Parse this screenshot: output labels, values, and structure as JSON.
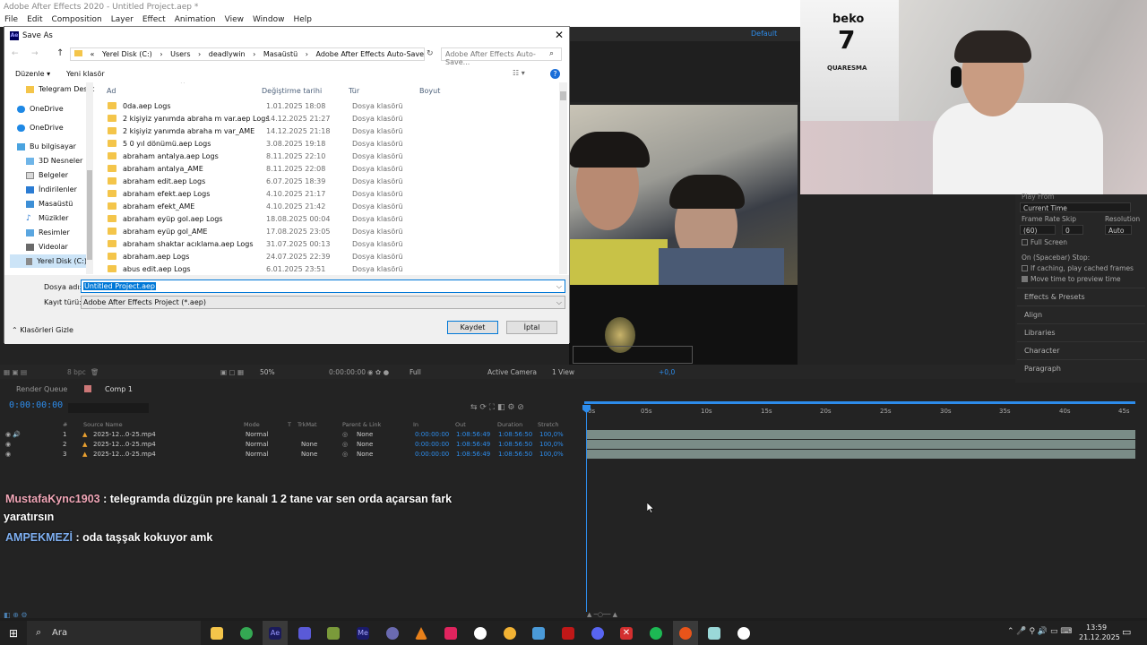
{
  "app": {
    "title": "Adobe After Effects 2020 - Untitled Project.aep *",
    "menu": [
      "File",
      "Edit",
      "Composition",
      "Layer",
      "Effect",
      "Animation",
      "View",
      "Window",
      "Help"
    ],
    "workspace": "Default"
  },
  "dialog": {
    "title": "Save As",
    "address": [
      "«",
      "Yerel Disk (C:)",
      "›",
      "Users",
      "›",
      "deadlywin",
      "›",
      "Masaüstü",
      "›",
      "Adobe After Effects Auto-Save",
      "›"
    ],
    "search_placeholder": "Adobe After Effects Auto-Save...",
    "organize": "Düzenle",
    "new_folder": "Yeni klasör",
    "nav_items": [
      "Telegram Deskt",
      "OneDrive",
      "OneDrive",
      "Bu bilgisayar",
      "3D Nesneler",
      "Belgeler",
      "İndirilenler",
      "Masaüstü",
      "Müzikler",
      "Resimler",
      "Videolar",
      "Yerel Disk (C:)"
    ],
    "columns": {
      "name": "Ad",
      "date": "Değiştirme tarihi",
      "type": "Tür",
      "size": "Boyut"
    },
    "files": [
      {
        "name": "0da.aep Logs",
        "date": "1.01.2025 18:08",
        "type": "Dosya klasörü"
      },
      {
        "name": "2 kişiyiz yanımda abraha m var.aep Logs",
        "date": "14.12.2025 21:27",
        "type": "Dosya klasörü"
      },
      {
        "name": "2 kişiyiz yanımda abraha m var_AME",
        "date": "14.12.2025 21:18",
        "type": "Dosya klasörü"
      },
      {
        "name": "5 0 yıl dönümü.aep Logs",
        "date": "3.08.2025 19:18",
        "type": "Dosya klasörü"
      },
      {
        "name": "abraham antalya.aep Logs",
        "date": "8.11.2025 22:10",
        "type": "Dosya klasörü"
      },
      {
        "name": "abraham antalya_AME",
        "date": "8.11.2025 22:08",
        "type": "Dosya klasörü"
      },
      {
        "name": "abraham edit.aep Logs",
        "date": "6.07.2025 18:39",
        "type": "Dosya klasörü"
      },
      {
        "name": "abraham efekt.aep Logs",
        "date": "4.10.2025 21:17",
        "type": "Dosya klasörü"
      },
      {
        "name": "abraham efekt_AME",
        "date": "4.10.2025 21:42",
        "type": "Dosya klasörü"
      },
      {
        "name": "abraham eyüp gol.aep Logs",
        "date": "18.08.2025 00:04",
        "type": "Dosya klasörü"
      },
      {
        "name": "abraham eyüp gol_AME",
        "date": "17.08.2025 23:05",
        "type": "Dosya klasörü"
      },
      {
        "name": "abraham shaktar acıklama.aep Logs",
        "date": "31.07.2025 00:13",
        "type": "Dosya klasörü"
      },
      {
        "name": "abraham.aep Logs",
        "date": "24.07.2025 22:39",
        "type": "Dosya klasörü"
      },
      {
        "name": "abus edit.aep Logs",
        "date": "6.01.2025 23:51",
        "type": "Dosya klasörü"
      }
    ],
    "filename_label": "Dosya adı:",
    "filename_value": "Untitled Project.aep",
    "filetype_label": "Kayıt türü:",
    "filetype_value": "Adobe After Effects Project (*.aep)",
    "hide_folders": "Klasörleri Gizle",
    "save_label": "Kaydet",
    "cancel_label": "İptal"
  },
  "props_panel": {
    "play_from": "Play From",
    "play_from_value": "Current Time",
    "frame_rate_label": "Frame Rate",
    "skip_label": "Skip",
    "resolution_label": "Resolution",
    "frame_rate_value": "(60)",
    "skip_value": "0",
    "resolution_value": "Auto",
    "full_screen": "Full Screen",
    "on_stop": "On (Spacebar) Stop:",
    "if_caching": "If caching, play cached frames",
    "move_time": "Move time to preview time",
    "panels": [
      "Effects & Presets",
      "Align",
      "Libraries",
      "Character",
      "Paragraph"
    ]
  },
  "viewer_bar": {
    "zoom": "50%",
    "timecode": "0:00:00:00",
    "quality": "Full",
    "camera": "Active Camera",
    "view": "1 View",
    "exposure": "+0,0",
    "bpc": "8 bpc"
  },
  "timeline": {
    "tabs": [
      "Render Queue",
      "Comp 1"
    ],
    "time": "0:00:00:00",
    "columns": [
      "#",
      "Source Name",
      "Mode",
      "T",
      "TrkMat",
      "Parent & Link",
      "In",
      "Out",
      "Duration",
      "Stretch"
    ],
    "ruler": [
      "0s",
      "05s",
      "10s",
      "15s",
      "20s",
      "25s",
      "30s",
      "35s",
      "40s",
      "45s"
    ],
    "layers": [
      {
        "num": "1",
        "name": "2025-12...0-25.mp4",
        "mode": "Normal",
        "trkmat": "",
        "parent": "None",
        "in": "0:00:00:00",
        "out": "1:08:56:49",
        "duration": "1:08:56:50",
        "stretch": "100,0%"
      },
      {
        "num": "2",
        "name": "2025-12...0-25.mp4",
        "mode": "Normal",
        "trkmat": "None",
        "parent": "None",
        "in": "0:00:00:00",
        "out": "1:08:56:49",
        "duration": "1:08:56:50",
        "stretch": "100,0%"
      },
      {
        "num": "3",
        "name": "2025-12...0-25.mp4",
        "mode": "Normal",
        "trkmat": "None",
        "parent": "None",
        "in": "0:00:00:00",
        "out": "1:08:56:49",
        "duration": "1:08:56:50",
        "stretch": "100,0%"
      }
    ]
  },
  "chat": [
    {
      "user": "MustafaKync1903",
      "text": ": telegramda düzgün pre kanalı 1 2 tane var sen orda açarsan fark",
      "cont": "yaratırsın",
      "color": "#f2a7b8"
    },
    {
      "user": "AMPEKMEZİ",
      "text": ": oda taşşak kokuyor amk",
      "color": "#7fb0f2"
    }
  ],
  "taskbar": {
    "search": "Ara",
    "time": "13:59",
    "date": "21.12.2025"
  },
  "cam_jersey": {
    "brand": "beko",
    "number": "7",
    "name": "QUARESMA"
  }
}
